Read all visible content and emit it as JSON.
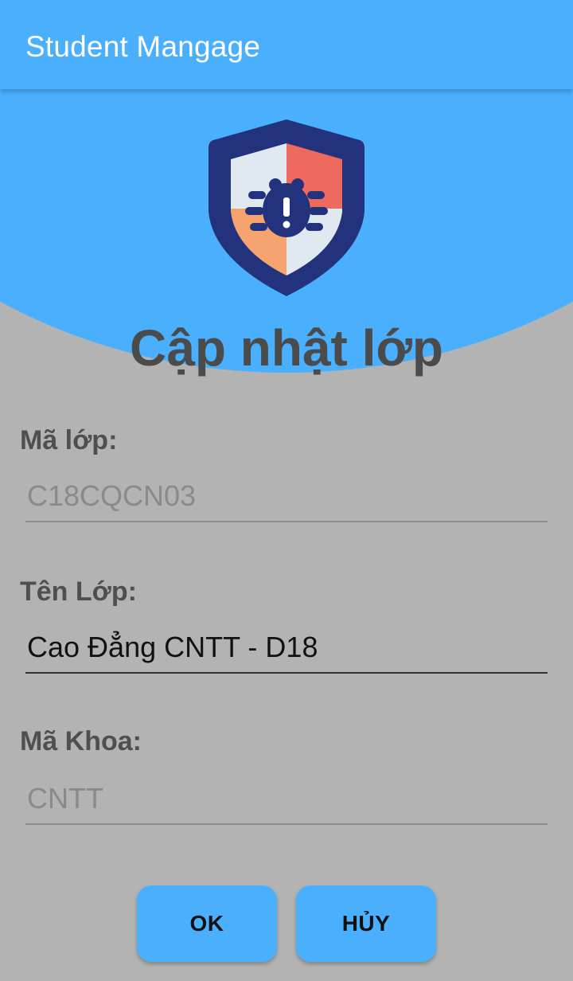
{
  "appbar": {
    "title": "Student Mangage"
  },
  "logo": {
    "icon": "shield-bug-icon",
    "colors": {
      "shield": "#23327d",
      "top_right": "#ef6a5e",
      "bottom_left": "#f5a470",
      "quadrant_light": "#dfe9ef"
    }
  },
  "heading": "Cập nhật lớp",
  "form": {
    "class_code": {
      "label": "Mã lớp:",
      "value": "C18CQCN03"
    },
    "class_name": {
      "label": "Tên Lớp:",
      "value": "Cao Đẳng CNTT - D18"
    },
    "faculty_code": {
      "label": "Mã Khoa:",
      "value": "CNTT"
    }
  },
  "buttons": {
    "ok": "OK",
    "cancel": "HỦY"
  },
  "colors": {
    "accent": "#4aaffc",
    "background": "#b3b3b3"
  }
}
